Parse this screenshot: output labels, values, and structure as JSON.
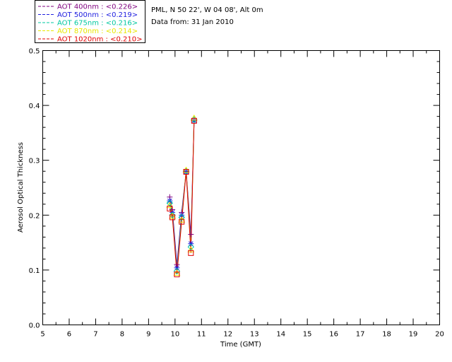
{
  "header": {
    "location": "PML, N 50 22', W 04 08', Alt 0m",
    "date": "Data from: 31 Jan 2010"
  },
  "chart_data": {
    "type": "line",
    "xlabel": "Time (GMT)",
    "ylabel": "Aerosol Optical Thickness",
    "xlim": [
      5,
      20
    ],
    "ylim": [
      0.0,
      0.5
    ],
    "x_ticks": [
      "5",
      "6",
      "7",
      "8",
      "9",
      "10",
      "11",
      "12",
      "13",
      "14",
      "15",
      "16",
      "17",
      "18",
      "19",
      "20"
    ],
    "y_ticks": [
      "0.0",
      "0.1",
      "0.2",
      "0.3",
      "0.4",
      "0.5"
    ],
    "grid": false,
    "legend_position": "top-left",
    "x": [
      9.8,
      9.9,
      10.07,
      10.25,
      10.42,
      10.6,
      10.72
    ],
    "series": [
      {
        "name": "AOT  400nm : <0.226>",
        "color": "#7f007f",
        "marker": "plus",
        "values": [
          0.233,
          0.21,
          0.11,
          0.205,
          0.28,
          0.165,
          0.372
        ]
      },
      {
        "name": "AOT  500nm : <0.219>",
        "color": "#2020e0",
        "marker": "asterisk",
        "values": [
          0.226,
          0.205,
          0.104,
          0.2,
          0.279,
          0.148,
          0.372
        ]
      },
      {
        "name": "AOT  675nm : <0.216>",
        "color": "#00c8a0",
        "marker": "diamond",
        "values": [
          0.222,
          0.2,
          0.098,
          0.196,
          0.28,
          0.142,
          0.374
        ]
      },
      {
        "name": "AOT  870nm : <0.214>",
        "color": "#e8e800",
        "marker": "triangle",
        "values": [
          0.218,
          0.198,
          0.094,
          0.191,
          0.282,
          0.137,
          0.377
        ]
      },
      {
        "name": "AOT 1020nm : <0.210>",
        "color": "#e00000",
        "marker": "square",
        "values": [
          0.212,
          0.196,
          0.092,
          0.188,
          0.279,
          0.131,
          0.372
        ]
      }
    ]
  }
}
